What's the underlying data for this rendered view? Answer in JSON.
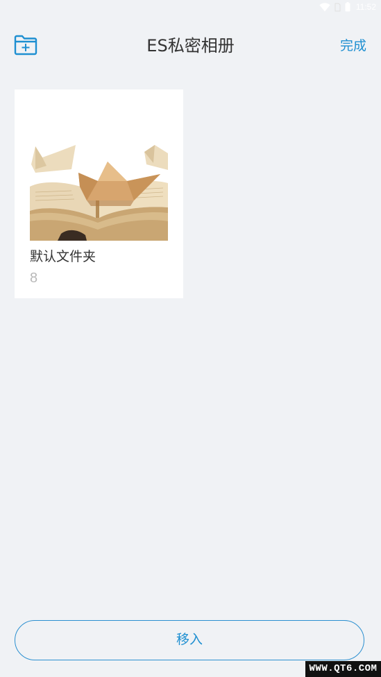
{
  "status_bar": {
    "time": "11:52",
    "icons": [
      "wifi-icon",
      "sim-icon",
      "battery-icon"
    ]
  },
  "header": {
    "title": "ES私密相册",
    "done_label": "完成",
    "add_folder_icon": "folder-plus-icon"
  },
  "albums": [
    {
      "name": "默认文件夹",
      "count": "8",
      "thumbnail": "paper-boats-on-book"
    }
  ],
  "footer": {
    "move_in_label": "移入"
  },
  "watermark": {
    "text": "WWW.QT6.COM"
  },
  "colors": {
    "background": "#f0f2f5",
    "accent": "#1e8fd1",
    "card": "#ffffff",
    "title_text": "#333333",
    "count_text": "#b8b8b8"
  }
}
